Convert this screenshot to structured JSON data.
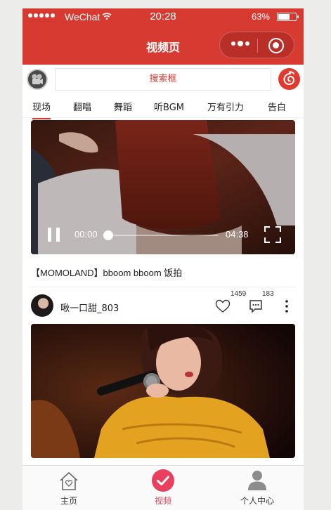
{
  "status_bar": {
    "carrier": "WeChat",
    "time": "20:28",
    "battery": "63%",
    "battery_level": 0.63
  },
  "nav": {
    "title": "视频页"
  },
  "search": {
    "placeholder": "搜索框"
  },
  "tabs": [
    {
      "label": "现场",
      "active": true
    },
    {
      "label": "翻唱",
      "active": false
    },
    {
      "label": "舞蹈",
      "active": false
    },
    {
      "label": "听BGM",
      "active": false
    },
    {
      "label": "万有引力",
      "active": false
    },
    {
      "label": "告白",
      "active": false
    }
  ],
  "player": {
    "current_time": "00:00",
    "duration": "04:38",
    "progress": 0
  },
  "post": {
    "title": "【MOMOLAND】bboom bboom 饭拍",
    "user": "啾一口甜_803",
    "likes": "1459",
    "comments": "183"
  },
  "bottom_nav": [
    {
      "label": "主页",
      "icon": "home-icon",
      "active": false
    },
    {
      "label": "视频",
      "icon": "check-circle-icon",
      "active": true
    },
    {
      "label": "个人中心",
      "icon": "person-icon",
      "active": false
    }
  ],
  "colors": {
    "brand_red": "#d73a31",
    "active_pink": "#e0405c"
  }
}
